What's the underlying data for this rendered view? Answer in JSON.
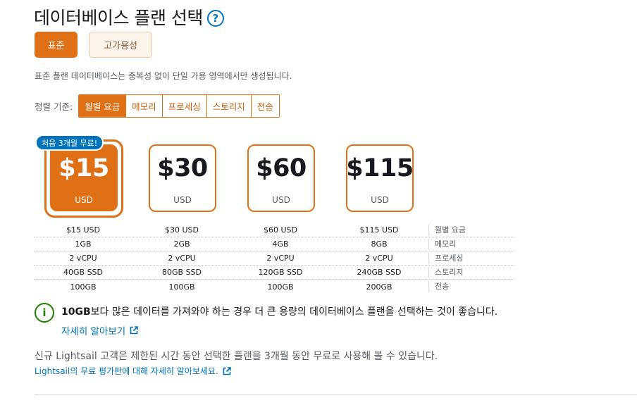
{
  "header": {
    "title": "데이터베이스 플랜 선택",
    "help_icon": "?"
  },
  "modes": [
    {
      "label": "표준",
      "active": true
    },
    {
      "label": "고가용성",
      "active": false
    }
  ],
  "description": "표준 플랜 데이터베이스는 중복성 없이 단일 가용 영역에서만 생성됩니다.",
  "sort": {
    "label": "정렬 기준:",
    "options": [
      {
        "label": "월별 요금",
        "active": true
      },
      {
        "label": "메모리",
        "active": false
      },
      {
        "label": "프로세싱",
        "active": false
      },
      {
        "label": "스토리지",
        "active": false
      },
      {
        "label": "전송",
        "active": false
      }
    ]
  },
  "badge": "처음 3개월 무료!",
  "plans": [
    {
      "price": "$15",
      "currency": "USD",
      "selected": true
    },
    {
      "price": "$30",
      "currency": "USD",
      "selected": false
    },
    {
      "price": "$60",
      "currency": "USD",
      "selected": false
    },
    {
      "price": "$115",
      "currency": "USD",
      "selected": false
    }
  ],
  "specs": [
    {
      "values": [
        "$15 USD",
        "$30 USD",
        "$60 USD",
        "$115 USD"
      ],
      "label": "월별 요금"
    },
    {
      "values": [
        "1GB",
        "2GB",
        "4GB",
        "8GB"
      ],
      "label": "메모리"
    },
    {
      "values": [
        "2 vCPU",
        "2 vCPU",
        "2 vCPU",
        "2 vCPU"
      ],
      "label": "프로세싱"
    },
    {
      "values": [
        "40GB SSD",
        "80GB SSD",
        "120GB SSD",
        "240GB SSD"
      ],
      "label": "스토리지"
    },
    {
      "values": [
        "100GB",
        "100GB",
        "100GB",
        "200GB"
      ],
      "label": "전송"
    }
  ],
  "info": {
    "bold": "10GB",
    "text": "보다 많은 데이터를 가져와야 하는 경우 더 큰 용량의 데이터베이스 플랜을 선택하는 것이 좋습니다.",
    "link": "자세히 알아보기"
  },
  "free_tier": {
    "text": "신규 Lightsail 고객은 제한된 시간 동안 선택한 플랜을 3개월 동안 무료로 사용해 볼 수 있습니다.",
    "link": "Lightsail의 무료 평가판에 대해 자세히 알아보세요."
  },
  "colors": {
    "accent": "#e07016",
    "link": "#0073bb",
    "success": "#1d8102"
  }
}
